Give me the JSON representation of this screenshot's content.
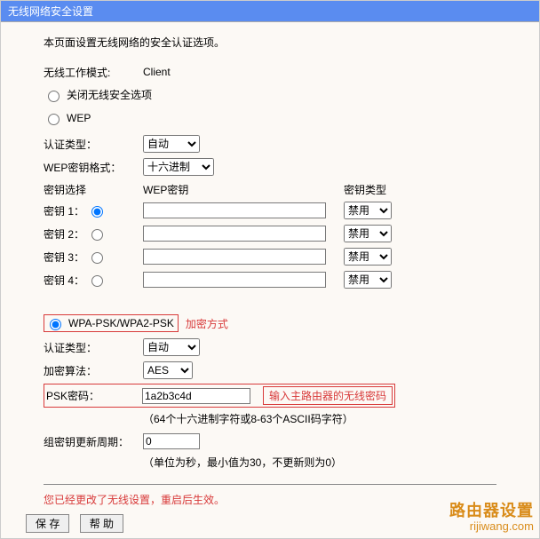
{
  "header": {
    "title": "无线网络安全设置"
  },
  "intro": "本页面设置无线网络的安全认证选项。",
  "wireless_mode": {
    "label": "无线工作模式:",
    "value": "Client"
  },
  "options": {
    "disable": "关闭无线安全选项",
    "wep": "WEP",
    "wpa": "WPA-PSK/WPA2-PSK"
  },
  "wep": {
    "auth_label": "认证类型：",
    "auth_value": "自动",
    "fmt_label": "WEP密钥格式：",
    "fmt_value": "十六进制",
    "header_keysel": "密钥选择",
    "header_wepkey": "WEP密钥",
    "header_keytype": "密钥类型",
    "keys": [
      {
        "label": "密钥 1：",
        "value": "",
        "type": "禁用"
      },
      {
        "label": "密钥 2：",
        "value": "",
        "type": "禁用"
      },
      {
        "label": "密钥 3：",
        "value": "",
        "type": "禁用"
      },
      {
        "label": "密钥 4：",
        "value": "",
        "type": "禁用"
      }
    ]
  },
  "wpa_annot": "加密方式",
  "wpa": {
    "auth_label": "认证类型：",
    "auth_value": "自动",
    "algo_label": "加密算法：",
    "algo_value": "AES",
    "psk_label": "PSK密码：",
    "psk_value": "1a2b3c4d",
    "psk_annot": "输入主路由器的无线密码",
    "psk_hint": "（64个十六进制字符或8-63个ASCII码字符）",
    "gk_label": "组密钥更新周期：",
    "gk_value": "0",
    "gk_hint": "（单位为秒，最小值为30，不更新则为0）"
  },
  "warn": "您已经更改了无线设置，重启后生效。",
  "buttons": {
    "save": "保 存",
    "help": "帮 助"
  },
  "watermark": {
    "line1": "路由器设置",
    "line2": "rijiwang.com"
  }
}
